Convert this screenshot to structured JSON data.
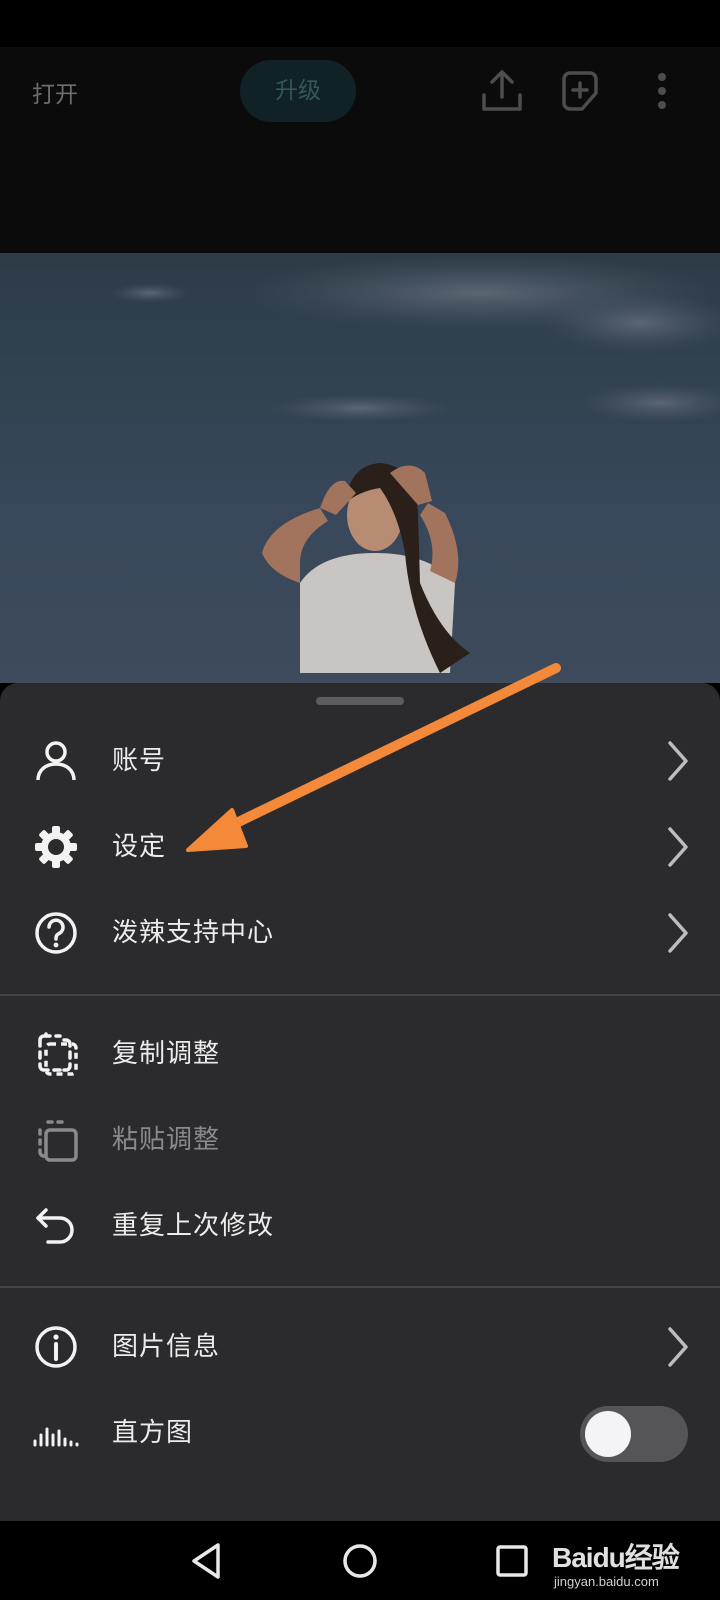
{
  "toolbar": {
    "open_label": "打开",
    "upgrade_label": "升级",
    "icons": [
      "share-icon",
      "add-icon",
      "more-vertical-icon"
    ]
  },
  "menu": {
    "section1": [
      {
        "label": "账号",
        "icon": "user-icon",
        "chevron": true
      },
      {
        "label": "设定",
        "icon": "gear-icon",
        "chevron": true
      },
      {
        "label": "泼辣支持中心",
        "icon": "help-icon",
        "chevron": true
      }
    ],
    "section2": [
      {
        "label": "复制调整",
        "icon": "copy-adjust-icon",
        "enabled": true
      },
      {
        "label": "粘贴调整",
        "icon": "paste-adjust-icon",
        "enabled": false
      },
      {
        "label": "重复上次修改",
        "icon": "undo-icon",
        "enabled": true
      }
    ],
    "section3": [
      {
        "label": "图片信息",
        "icon": "info-icon",
        "chevron": true
      },
      {
        "label": "直方图",
        "icon": "histogram-icon",
        "toggle": false
      }
    ]
  },
  "watermark": {
    "brand": "Baidu经验",
    "url": "jingyan.baidu.com"
  },
  "colors": {
    "sheet_bg": "#2b2b2d",
    "annotation_arrow": "#f5893a",
    "upgrade_bg": "#112226"
  }
}
